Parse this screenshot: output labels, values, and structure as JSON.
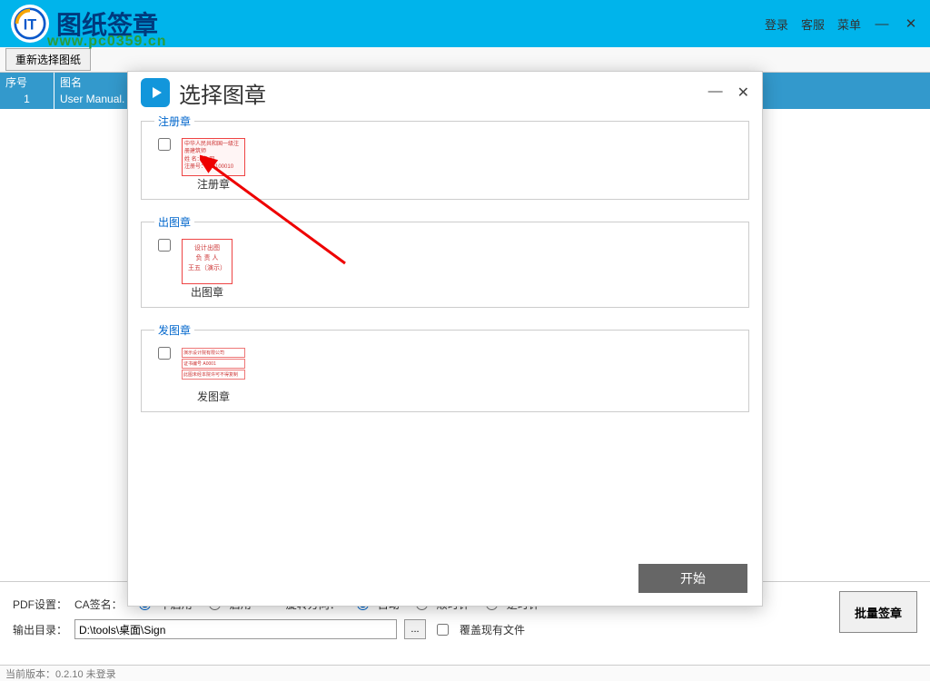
{
  "app": {
    "title": "图纸签章",
    "watermark": "www.pc0359.cn"
  },
  "titleActions": {
    "login": "登录",
    "service": "客服",
    "menu": "菜单",
    "minimize": "—",
    "close": "✕"
  },
  "toolbar": {
    "reselect": "重新选择图纸"
  },
  "grid": {
    "headers": {
      "num": "序号",
      "name": "图名"
    },
    "rows": [
      {
        "num": "1",
        "name": "User Manual."
      }
    ]
  },
  "pdf": {
    "label": "PDF设置：",
    "caLabel": "CA签名：",
    "caOptions": {
      "disable": "不启用",
      "enable": "启用"
    },
    "rotateLabel": "旋转方向：",
    "rotateOptions": {
      "auto": "自动",
      "cw": "顺时针",
      "ccw": "逆时针"
    }
  },
  "output": {
    "label": "输出目录：",
    "path": "D:\\tools\\桌面\\Sign",
    "browse": "...",
    "overwrite": "覆盖现有文件"
  },
  "batchSign": "批量签章",
  "status": {
    "prefix": "当前版本：",
    "version": "0.2.10 未登录"
  },
  "dialog": {
    "title": "选择图章",
    "minimize": "—",
    "close": "✕",
    "sections": {
      "register": {
        "legend": "注册章",
        "label": "注册章"
      },
      "output": {
        "legend": "出图章",
        "label": "出图章",
        "lines": {
          "a": "设计出图",
          "b": "负 责 人",
          "c": "王五（演示）"
        }
      },
      "publish": {
        "legend": "发图章",
        "label": "发图章"
      }
    },
    "start": "开始"
  }
}
